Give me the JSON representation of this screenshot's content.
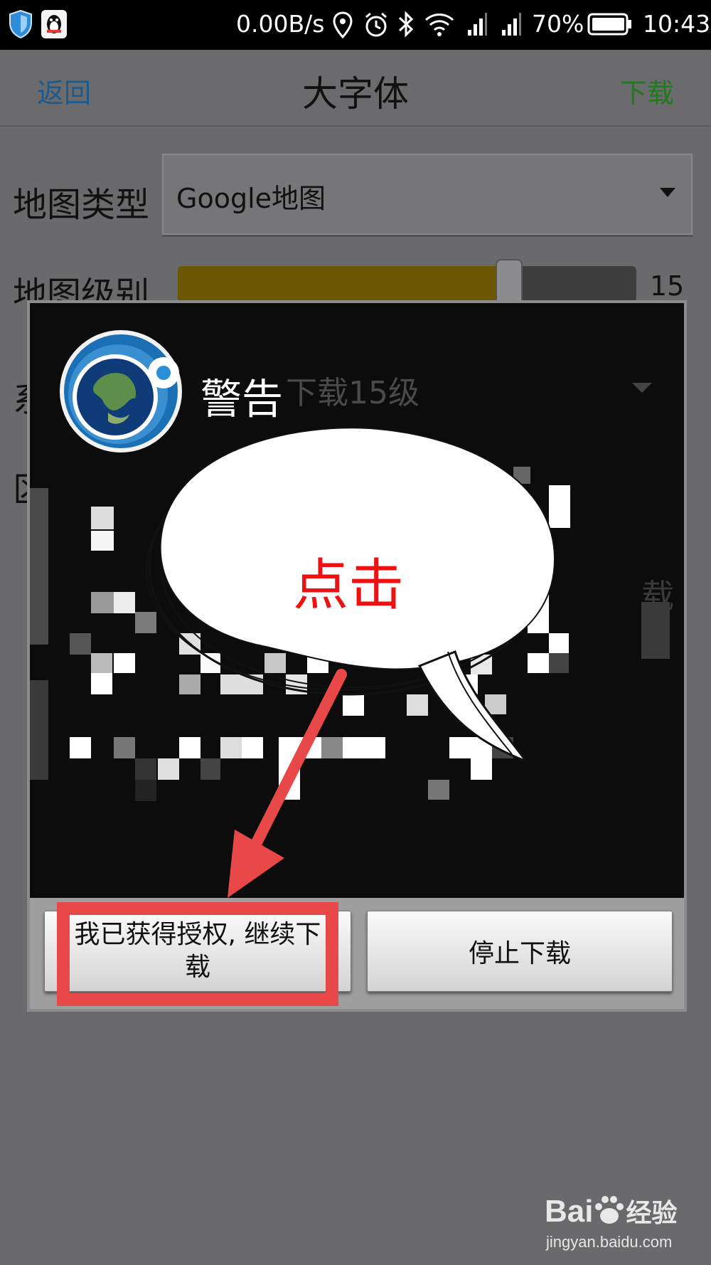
{
  "status_bar": {
    "network_speed": "0.00B/s",
    "battery_percent": "70%",
    "time": "10:43",
    "icons": [
      "shield-icon",
      "qq-penguin-icon",
      "location-icon",
      "alarm-icon",
      "bluetooth-icon",
      "wifi-icon",
      "signal-icon",
      "signal-icon",
      "battery-icon"
    ]
  },
  "action_bar": {
    "back_label": "返回",
    "title": "大字体",
    "download_label": "下载"
  },
  "form": {
    "map_type_label": "地图类型",
    "map_type_value": "Google地图",
    "map_level_label": "地图级别",
    "map_level_value": "15",
    "map_level_fraction": 0.72,
    "row3_label_partial": "系",
    "row3_value_partial": "下载15级",
    "region_label": "区域"
  },
  "dialog": {
    "title": "警告",
    "continue_button": "我已获得授权, 继续下载",
    "stop_button": "停止下载",
    "content_partial": "载"
  },
  "annotation": {
    "callout_text": "点击",
    "highlight_color": "#e84848",
    "arrow_color": "#e84848"
  },
  "watermark": {
    "brand_a": "Bai",
    "brand_b": "经验",
    "url": "jingyan.baidu.com"
  }
}
